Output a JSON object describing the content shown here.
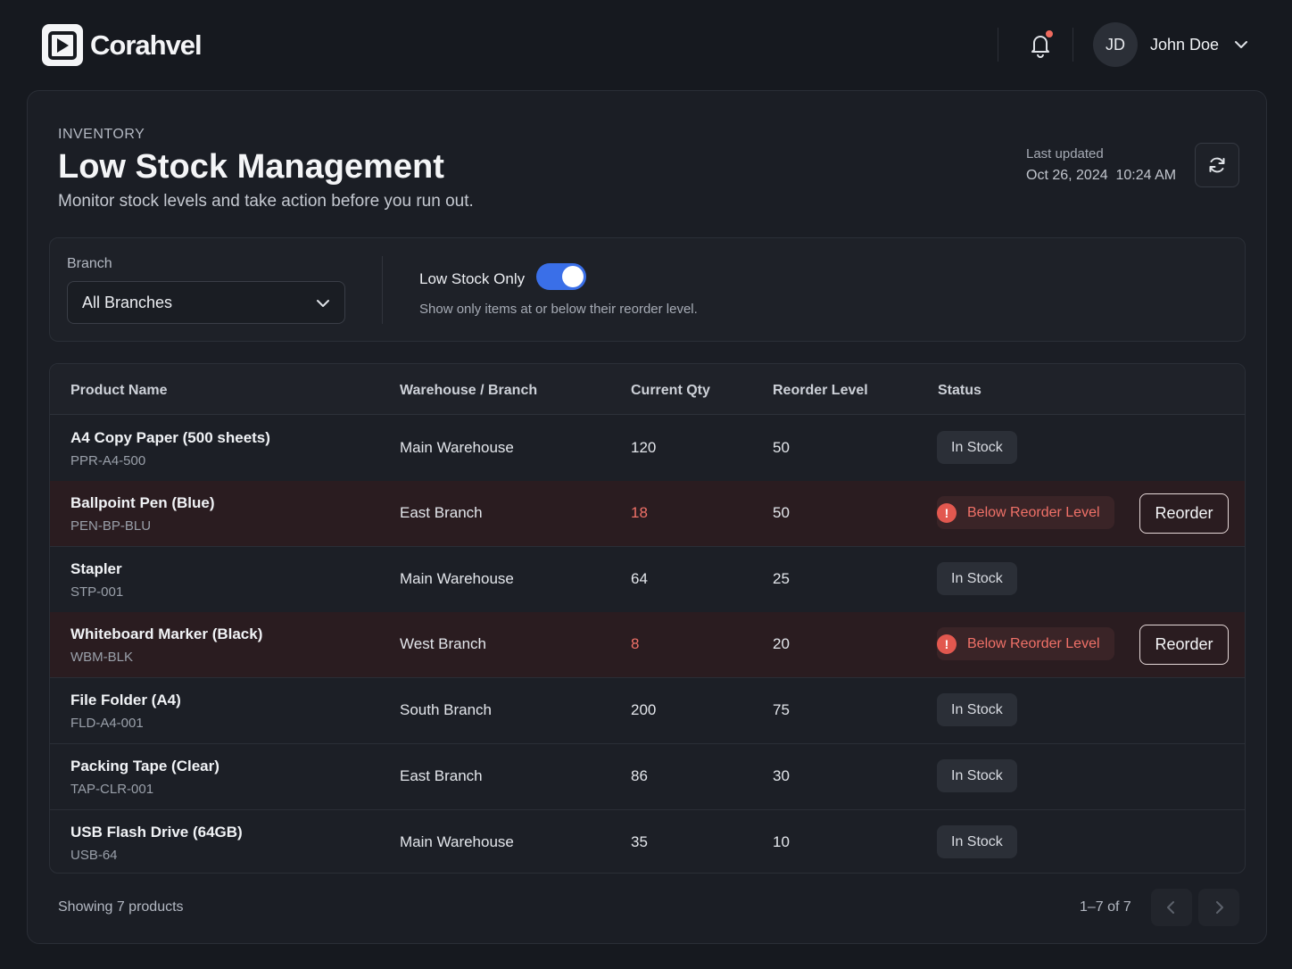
{
  "app": {
    "name": "Corahvel"
  },
  "user": {
    "initials": "JD",
    "name": "John Doe"
  },
  "header": {
    "eyebrow": "INVENTORY",
    "title": "Low Stock Management",
    "subtitle": "Monitor stock levels and take action before you run out.",
    "last_updated_label": "Last updated",
    "last_updated_value": "Oct 26, 2024  10:24 AM"
  },
  "filters": {
    "branch_label": "Branch",
    "branch_value": "All Branches",
    "toggle_label": "Low Stock Only",
    "toggle_on": true,
    "toggle_description": "Show only items at or below their reorder level."
  },
  "table": {
    "columns": [
      "Product Name",
      "Warehouse / Branch",
      "Current Qty",
      "Reorder Level",
      "Status"
    ],
    "reorder_label": "Reorder",
    "rows": [
      {
        "name": "A4 Copy Paper (500 sheets)",
        "sku": "PPR-A4-500",
        "branch": "Main Warehouse",
        "qty": "120",
        "reorder": "50",
        "status": "In Stock"
      },
      {
        "name": "Ballpoint Pen (Blue)",
        "sku": "PEN-BP-BLU",
        "branch": "East Branch",
        "qty": "18",
        "reorder": "50",
        "status": "Below Reorder Level"
      },
      {
        "name": "Stapler",
        "sku": "STP-001",
        "branch": "Main Warehouse",
        "qty": "64",
        "reorder": "25",
        "status": "In Stock"
      },
      {
        "name": "Whiteboard Marker (Black)",
        "sku": "WBM-BLK",
        "branch": "West Branch",
        "qty": "8",
        "reorder": "20",
        "status": "Below Reorder Level"
      },
      {
        "name": "File Folder (A4)",
        "sku": "FLD-A4-001",
        "branch": "South Branch",
        "qty": "200",
        "reorder": "75",
        "status": "In Stock"
      },
      {
        "name": "Packing Tape (Clear)",
        "sku": "TAP-CLR-001",
        "branch": "East Branch",
        "qty": "86",
        "reorder": "30",
        "status": "In Stock"
      },
      {
        "name": "USB Flash Drive (64GB)",
        "sku": "USB-64",
        "branch": "Main Warehouse",
        "qty": "35",
        "reorder": "10",
        "status": "In Stock"
      }
    ]
  },
  "footer": {
    "showing": "Showing 7 products",
    "range": "1–7 of 7"
  },
  "colors": {
    "accent": "#3a6fe8",
    "danger": "#f07168",
    "background": "#16191f"
  },
  "icons": [
    "logo-icon",
    "bell-icon",
    "chevron-down-icon",
    "refresh-icon",
    "alert-icon",
    "chevron-left-icon",
    "chevron-right-icon"
  ]
}
